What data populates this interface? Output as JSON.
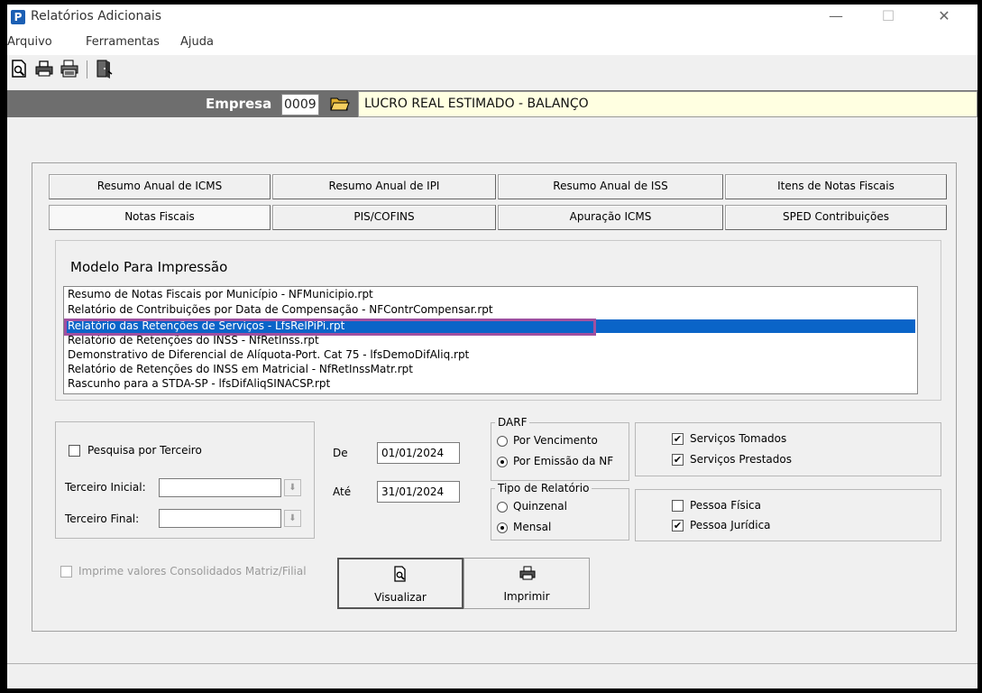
{
  "window": {
    "app_icon": "P",
    "title": "Relatórios Adicionais",
    "controls": [
      "—",
      "☐",
      "✕"
    ]
  },
  "menu": [
    "Arquivo",
    "Ferramentas",
    "Ajuda"
  ],
  "toolbar": {
    "icons": [
      "preview-icon",
      "print-icon",
      "print-setup-icon",
      "exit-door-icon"
    ]
  },
  "empresa": {
    "label": "Empresa",
    "code": "0009",
    "name": "LUCRO REAL ESTIMADO - BALANÇO"
  },
  "tabs": {
    "row1": [
      "Resumo Anual de ICMS",
      "Resumo Anual de IPI",
      "Resumo Anual de ISS",
      "Itens de Notas Fiscais"
    ],
    "row2": [
      "Notas Fiscais",
      "PIS/COFINS",
      "Apuração ICMS",
      "SPED Contribuições"
    ],
    "active": "Notas Fiscais"
  },
  "modelo": {
    "title": "Modelo Para Impressão",
    "items": [
      "Resumo de Notas Fiscais por Município - NFMunicipio.rpt",
      "Relatório de Contribuições por Data de Compensação - NFContrCompensar.rpt",
      "Relatório das Retenções de Serviços - LfsRelPiPi.rpt",
      "Relatório de Retenções do INSS - NfRetInss.rpt",
      "Demonstrativo de Diferencial de Alíquota-Port. Cat 75 - lfsDemoDifAliq.rpt",
      "Relatório de Retenções do INSS em Matricial - NfRetInssMatr.rpt",
      "Rascunho para a STDA-SP - lfsDifAliqSINACSP.rpt"
    ],
    "selected_index": 2
  },
  "terceiro": {
    "pesquisa_label": "Pesquisa por Terceiro",
    "inicial_label": "Terceiro Inicial:",
    "final_label": "Terceiro Final:",
    "inicial_value": "",
    "final_value": ""
  },
  "periodo": {
    "de_label": "De",
    "de_value": "01/01/2024",
    "ate_label": "Até",
    "ate_value": "31/01/2024"
  },
  "darf": {
    "legend": "DARF",
    "options": [
      "Por Vencimento",
      "Por Emissão da NF"
    ],
    "selected": "Por Emissão da NF"
  },
  "tipo_relatorio": {
    "legend": "Tipo de Relatório",
    "options": [
      "Quinzenal",
      "Mensal"
    ],
    "selected": "Mensal"
  },
  "servicos": {
    "tomados_label": "Serviços Tomados",
    "tomados_checked": true,
    "prestados_label": "Serviços Prestados",
    "prestados_checked": true
  },
  "pessoa": {
    "fisica_label": "Pessoa Física",
    "fisica_checked": false,
    "juridica_label": "Pessoa Jurídica",
    "juridica_checked": true
  },
  "consolidados_label": "Imprime valores Consolidados Matriz/Filial",
  "actions": {
    "visualizar": "Visualizar",
    "imprimir": "Imprimir"
  },
  "colors": {
    "selection": "#0a64c8",
    "highlight_box": "#a050a0",
    "empresa_bar": "#6e6e6e",
    "empresa_name_bg": "#ffffe1"
  }
}
